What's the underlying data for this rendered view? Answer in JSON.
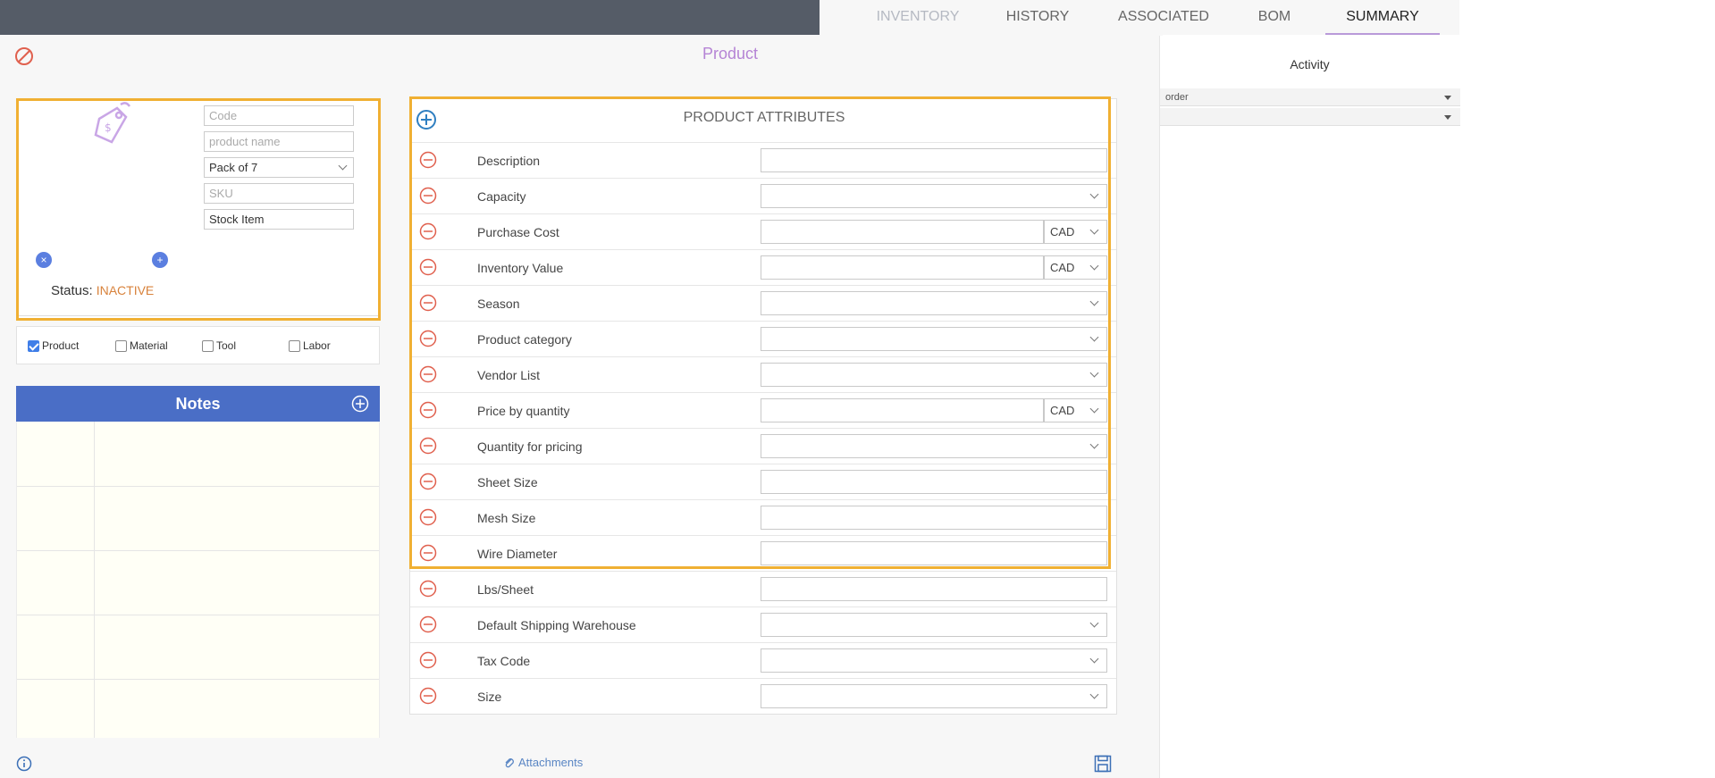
{
  "tabs": [
    {
      "label": "INVENTORY"
    },
    {
      "label": "HISTORY"
    },
    {
      "label": "ASSOCIATED"
    },
    {
      "label": "BOM"
    },
    {
      "label": "SUMMARY"
    }
  ],
  "page_title": "Product",
  "product_card": {
    "code_placeholder": "Code",
    "name_placeholder": "product name",
    "pack_value": "Pack of 7",
    "sku_placeholder": "SKU",
    "stock_value": "Stock Item",
    "status_label": "Status:",
    "status_value": "INACTIVE"
  },
  "types": {
    "product": "Product",
    "material": "Material",
    "tool": "Tool",
    "labor": "Labor"
  },
  "notes": {
    "title": "Notes"
  },
  "attributes": {
    "title": "PRODUCT ATTRIBUTES",
    "rows": [
      {
        "label": "Description",
        "kind": "text"
      },
      {
        "label": "Capacity",
        "kind": "select"
      },
      {
        "label": "Purchase Cost",
        "kind": "currency",
        "currency": "CAD"
      },
      {
        "label": "Inventory Value",
        "kind": "currency",
        "currency": "CAD"
      },
      {
        "label": "Season",
        "kind": "select"
      },
      {
        "label": "Product category",
        "kind": "select"
      },
      {
        "label": "Vendor List",
        "kind": "select"
      },
      {
        "label": "Price by quantity",
        "kind": "currency",
        "currency": "CAD"
      },
      {
        "label": "Quantity for pricing",
        "kind": "select"
      },
      {
        "label": "Sheet Size",
        "kind": "text"
      },
      {
        "label": "Mesh Size",
        "kind": "text"
      },
      {
        "label": "Wire Diameter",
        "kind": "text"
      },
      {
        "label": "Lbs/Sheet",
        "kind": "text"
      },
      {
        "label": "Default Shipping Warehouse",
        "kind": "select"
      },
      {
        "label": "Tax Code",
        "kind": "select"
      },
      {
        "label": "Size",
        "kind": "select"
      }
    ]
  },
  "footer": {
    "attachments": "Attachments"
  },
  "activity": {
    "title": "Activity",
    "order_select": "order",
    "second_select": ""
  },
  "colors": {
    "accent_purple": "#b584d5",
    "highlight_orange": "#f0b033",
    "notes_blue": "#4a6ec6",
    "minus_red": "#e0604e",
    "status_orange": "#d8823b"
  }
}
